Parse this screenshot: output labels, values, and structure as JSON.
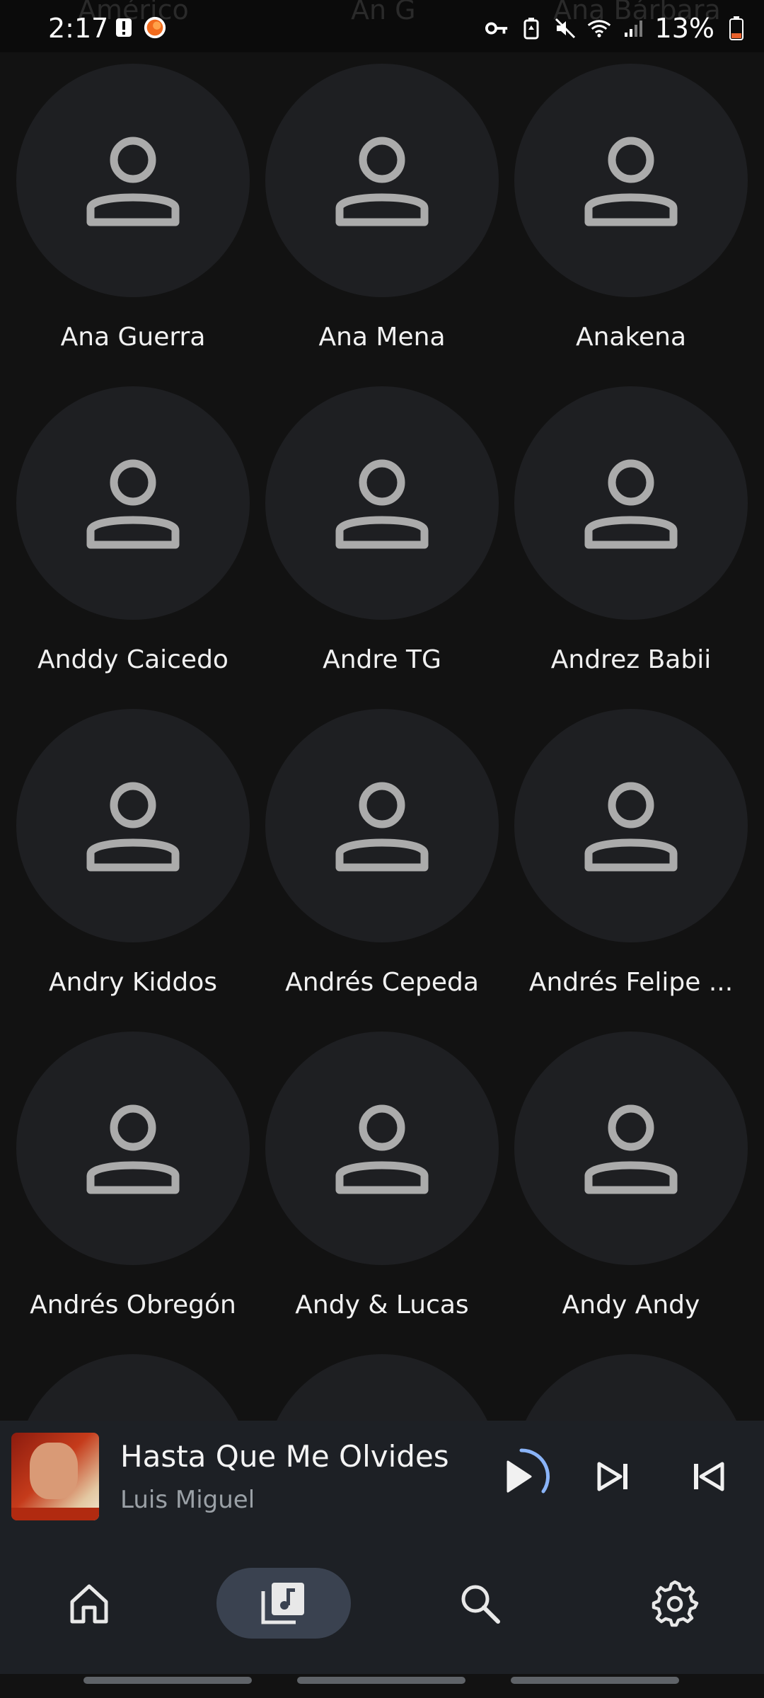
{
  "status_bar": {
    "time": "2:17",
    "battery_percent": "13%",
    "ghost_labels": [
      "Américo",
      "An G",
      "Ana Bárbara"
    ]
  },
  "artists": [
    {
      "name": "Ana Guerra"
    },
    {
      "name": "Ana Mena"
    },
    {
      "name": "Anakena"
    },
    {
      "name": "Anddy Caicedo"
    },
    {
      "name": "Andre TG"
    },
    {
      "name": "Andrez Babii"
    },
    {
      "name": "Andry Kiddos"
    },
    {
      "name": "Andrés Cepeda"
    },
    {
      "name": "Andrés Felipe ..."
    },
    {
      "name": "Andrés Obregón"
    },
    {
      "name": "Andy & Lucas"
    },
    {
      "name": "Andy Andy"
    }
  ],
  "player": {
    "title": "Hasta Que Me Olvides",
    "artist": "Luis Miguel"
  },
  "nav": {
    "items": [
      "home-icon",
      "library-icon",
      "search-icon",
      "settings-icon"
    ],
    "active": "library-icon"
  },
  "colors": {
    "background": "#121212",
    "avatar": "#1e1f22",
    "player": "#1d2025",
    "accent": "#8ab4f8"
  }
}
